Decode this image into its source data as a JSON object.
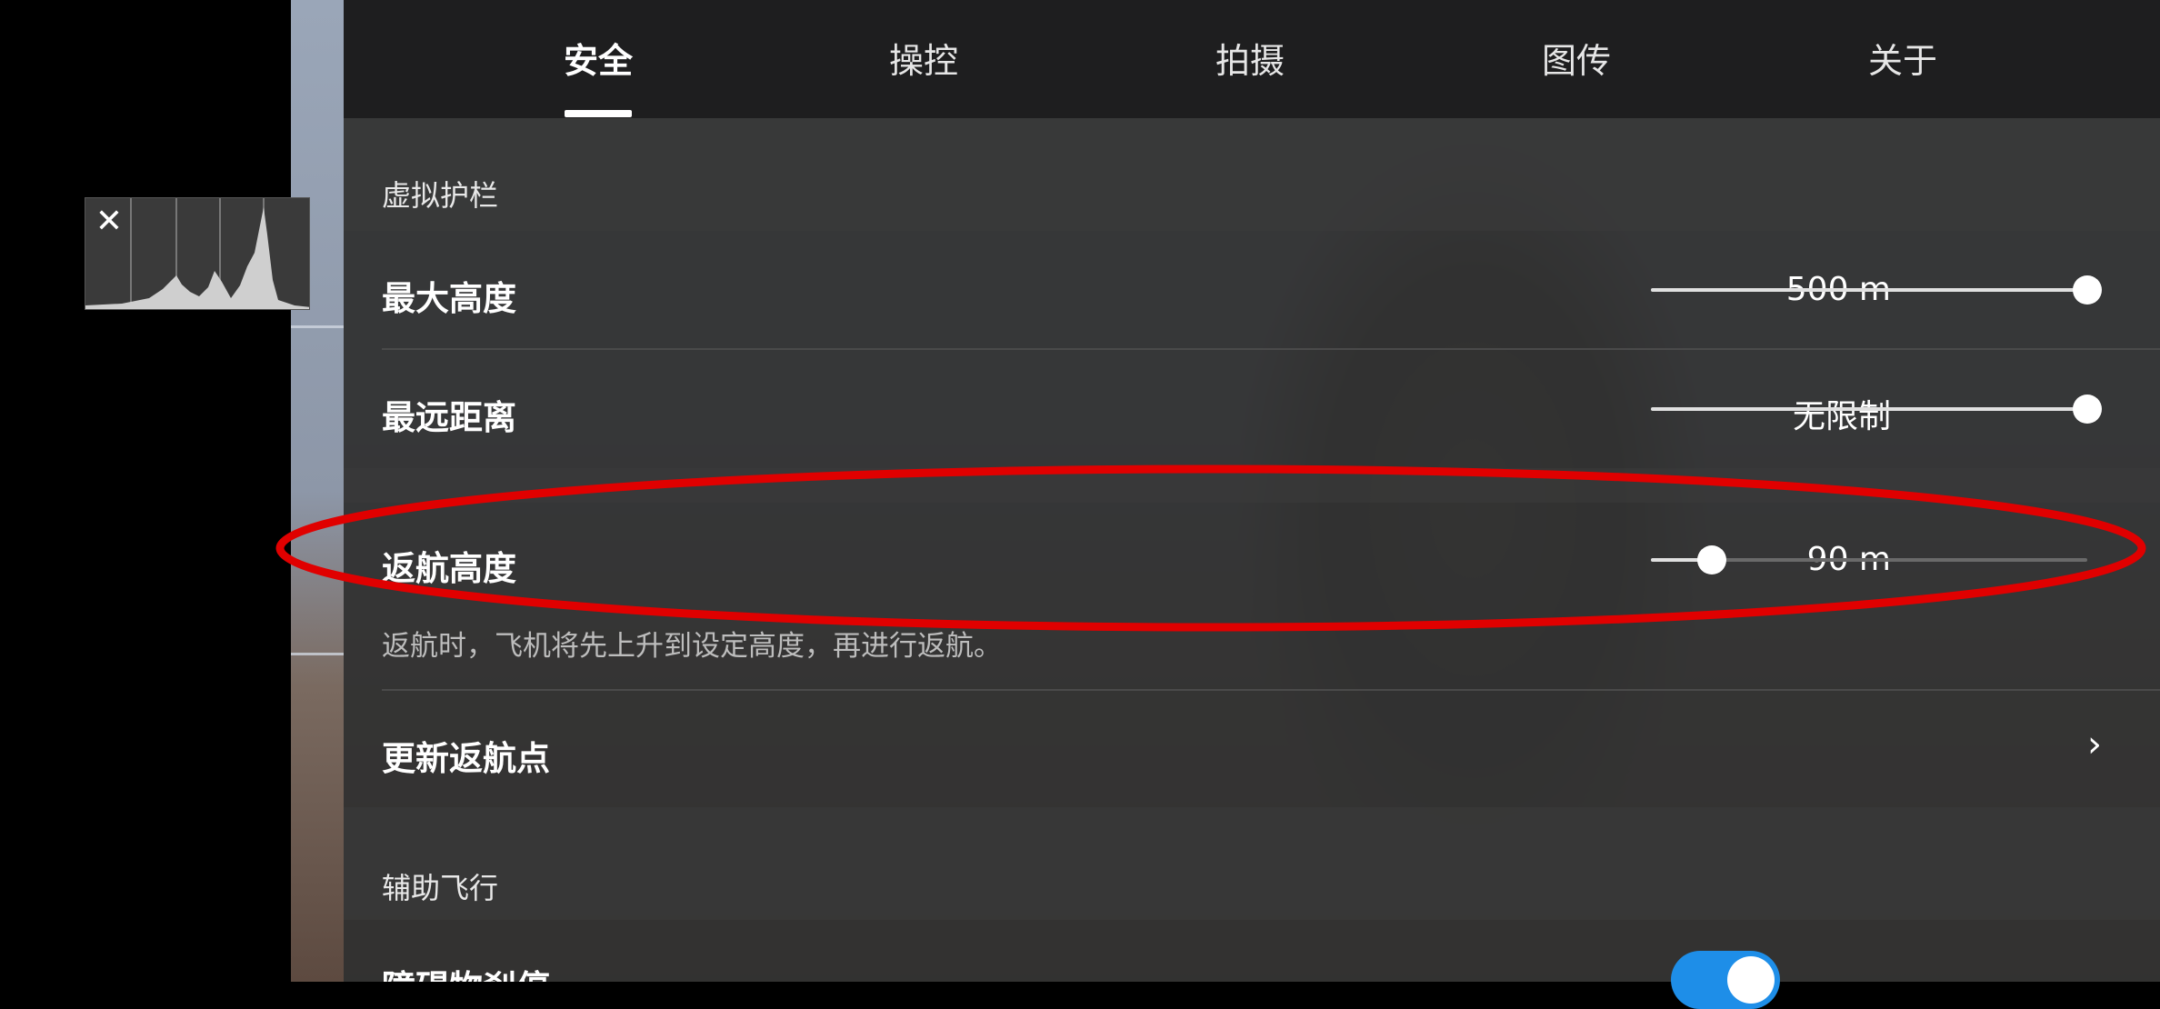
{
  "tabs": [
    {
      "label": "安全",
      "active": true
    },
    {
      "label": "操控",
      "active": false
    },
    {
      "label": "拍摄",
      "active": false
    },
    {
      "label": "图传",
      "active": false
    },
    {
      "label": "关于",
      "active": false
    }
  ],
  "histogram": {
    "close_icon": "close-icon",
    "close_glyph": "✕"
  },
  "sections": {
    "virtual_fence": {
      "title": "虚拟护栏",
      "max_altitude": {
        "label": "最大高度",
        "value": "500 m",
        "slider_fraction": 1.0
      },
      "max_distance": {
        "label": "最远距离",
        "value": "无限制",
        "slider_fraction": 1.0
      }
    },
    "return_to_home": {
      "altitude": {
        "label": "返航高度",
        "value": "90 m",
        "slider_fraction": 0.14
      },
      "description": "返航时，飞机将先上升到设定高度，再进行返航。",
      "update_home": {
        "label": "更新返航点",
        "icon": "chevron-right-icon",
        "glyph": "›"
      }
    },
    "assisted_flight": {
      "title": "辅助飞行",
      "obstacle_braking": {
        "label": "障碍物刹停",
        "toggle_on": true
      }
    }
  },
  "colors": {
    "accent": "#1e8ee8",
    "annotation": "#e00000",
    "panel": "#303030"
  }
}
